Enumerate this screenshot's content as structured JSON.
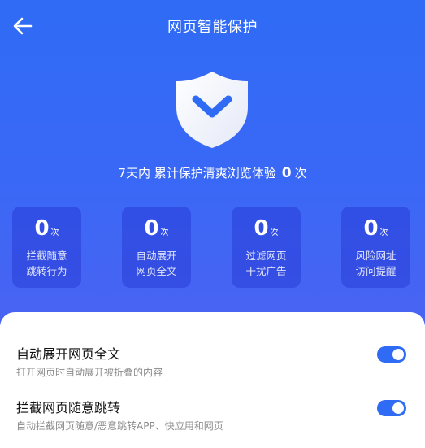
{
  "header": {
    "title": "网页智能保护",
    "back_icon": "arrow-left-icon"
  },
  "hero": {
    "shield_icon": "shield-check-icon",
    "summary_text": "7天内 累计保护清爽浏览体验",
    "summary_count": "0",
    "summary_unit": "次"
  },
  "stats": [
    {
      "value": "0",
      "unit": "次",
      "line1": "拦截随意",
      "line2": "跳转行为"
    },
    {
      "value": "0",
      "unit": "次",
      "line1": "自动展开",
      "line2": "网页全文"
    },
    {
      "value": "0",
      "unit": "次",
      "line1": "过滤网页",
      "line2": "干扰广告"
    },
    {
      "value": "0",
      "unit": "次",
      "line1": "风险网址",
      "line2": "访问提醒"
    }
  ],
  "settings": [
    {
      "title": "自动展开网页全文",
      "desc": "打开网页时自动展开被折叠的内容",
      "enabled": true
    },
    {
      "title": "拦截网页随意跳转",
      "desc": "自动拦截网页随意/恶意跳转APP、快应用和网页",
      "enabled": true
    }
  ],
  "colors": {
    "accent": "#2f6bf5",
    "hero_gradient_end": "#4a63f2",
    "card_bg": "#2a3cd8"
  }
}
